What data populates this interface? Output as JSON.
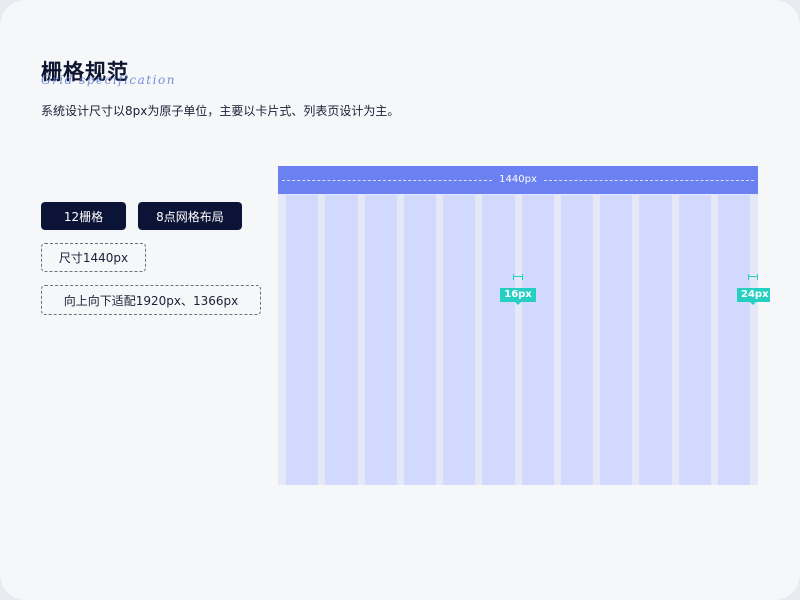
{
  "header": {
    "title": "栅格规范",
    "subtitle_script": "Grid specification",
    "description": "系统设计尺寸以8px为原子单位，主要以卡片式、列表页设计为主。"
  },
  "tags": [
    {
      "label": "12栅格",
      "style": "dark"
    },
    {
      "label": "8点网格布局",
      "style": "dark"
    },
    {
      "label": "尺寸1440px",
      "style": "outline"
    },
    {
      "label": "向上向下适配1920px、1366px",
      "style": "outline"
    }
  ],
  "grid": {
    "width_label": "1440px",
    "columns": 12,
    "gutter_label": "16px",
    "margin_label": "24px"
  },
  "colors": {
    "accent": "#6b81f2",
    "column": "#d1d9fe",
    "tag_dark": "#0b1436",
    "measure": "#25d0c2"
  }
}
